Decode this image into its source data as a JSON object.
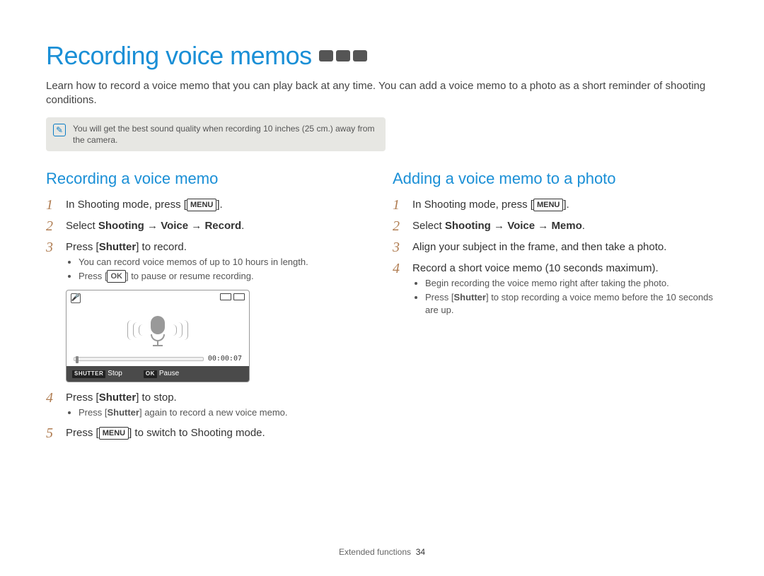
{
  "title": "Recording voice memos",
  "intro": "Learn how to record a voice memo that you can play back at any time. You can add a voice memo to a photo as a short reminder of shooting conditions.",
  "note": "You will get the best sound quality when recording 10 inches (25 cm.) away from the camera.",
  "left": {
    "heading": "Recording a voice memo",
    "step1_pre": "In Shooting mode, press [",
    "step1_key": "MENU",
    "step1_post": "].",
    "step2": "Select Shooting → Voice → Record.",
    "step3_pre": "Press [",
    "step3_bold": "Shutter",
    "step3_post": "] to record.",
    "step3_bullets": {
      "b1": "You can record voice memos of up to 10 hours in length.",
      "b2_pre": "Press [",
      "b2_key": "OK",
      "b2_post": "] to pause or resume recording."
    },
    "screen": {
      "time": "00:00:07",
      "stop_key": "SHUTTER",
      "stop_label": "Stop",
      "pause_key": "OK",
      "pause_label": "Pause"
    },
    "step4_pre": "Press [",
    "step4_bold": "Shutter",
    "step4_post": "] to stop.",
    "step4_bullets": {
      "b1_pre": "Press [",
      "b1_bold": "Shutter",
      "b1_post": "] again to record a new voice memo."
    },
    "step5_pre": "Press [",
    "step5_key": "MENU",
    "step5_post": "] to switch to Shooting mode."
  },
  "right": {
    "heading": "Adding a voice memo to a photo",
    "step1_pre": "In Shooting mode, press [",
    "step1_key": "MENU",
    "step1_post": "].",
    "step2": "Select Shooting → Voice → Memo.",
    "step3": "Align your subject in the frame, and then take a photo.",
    "step4": "Record a short voice memo (10 seconds maximum).",
    "step4_bullets": {
      "b1": "Begin recording the voice memo right after taking the photo.",
      "b2_pre": "Press [",
      "b2_bold": "Shutter",
      "b2_post": "] to stop recording a voice memo before the 10 seconds are up."
    }
  },
  "footer": {
    "section": "Extended functions",
    "page": "34"
  },
  "step_numbers": {
    "n1": "1",
    "n2": "2",
    "n3": "3",
    "n4": "4",
    "n5": "5"
  }
}
